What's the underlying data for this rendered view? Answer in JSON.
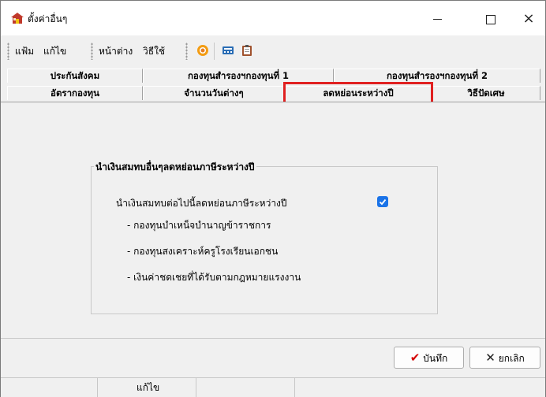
{
  "window": {
    "title": "ตั้งค่าอื่นๆ",
    "icon": "house-app-icon",
    "controls": {
      "minimize": "minimize-icon",
      "maximize": "maximize-icon",
      "close": "×"
    }
  },
  "menu": {
    "items": [
      "แฟ้ม",
      "แก้ไข",
      "หน้าต่าง",
      "วิธีใช้"
    ],
    "toolbar_icons": [
      "record-icon",
      "calculator-icon",
      "clipboard-icon"
    ]
  },
  "tabs": {
    "row1": [
      "ประกันสังคม",
      "กองทุนสำรองฯกองทุนที่ 1",
      "กองทุนสำรองฯกองทุนที่ 2"
    ],
    "row2": [
      "อัตรากองทุน",
      "จำนวนวันต่างๆ",
      "ลดหย่อนระหว่างปี",
      "วิธีปัดเศษ"
    ],
    "active": "ลดหย่อนระหว่างปี",
    "highlight_color": "#e02020"
  },
  "group": {
    "title": "นำเงินสมทบอื่นๆลดหย่อนภาษีระหว่างปี",
    "option_label": "นำเงินสมทบต่อไปนี้ลดหย่อนภาษีระหว่างปี",
    "option_checked": true,
    "items": [
      "- กองทุนบำเหน็จบำนาญข้าราชการ",
      "- กองทุนสงเคราะห์ครูโรงเรียนเอกชน",
      "- เงินค่าชดเชยที่ได้รับตามกฎหมายแรงงาน"
    ]
  },
  "buttons": {
    "save": "บันทึก",
    "cancel": "ยกเลิก"
  },
  "status": {
    "mode": "แก้ไข"
  },
  "colors": {
    "accent": "#1a73e8",
    "save_check": "#d40000"
  }
}
